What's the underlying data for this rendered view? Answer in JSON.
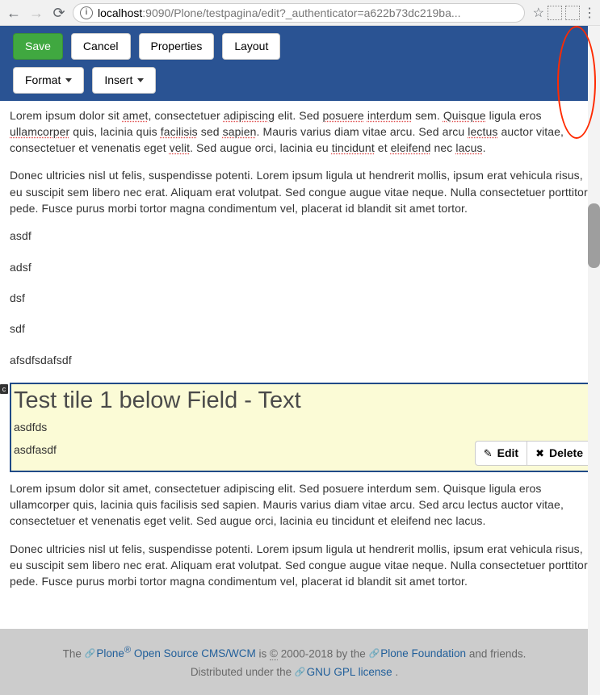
{
  "browser": {
    "url_prefix": "localhost",
    "url_suffix": ":9090/Plone/testpagina/edit?_authenticator=a622b73dc219ba...",
    "info_glyph": "i",
    "star_glyph": "☆",
    "menu_glyph": "⋮"
  },
  "toolbar": {
    "save": "Save",
    "cancel": "Cancel",
    "properties": "Properties",
    "layout": "Layout",
    "format": "Format",
    "insert": "Insert"
  },
  "content": {
    "para1_parts": {
      "t0": "Lorem ipsum dolor sit ",
      "w0": "amet",
      "t1": ", consectetuer ",
      "w1": "adipiscing",
      "t2": " elit. Sed ",
      "w2": "posuere",
      "t3": " ",
      "w3": "interdum",
      "t4": " sem. ",
      "w4": "Quisque",
      "t5": " ligula eros ",
      "w5": "ullamcorper",
      "t6": " quis, lacinia quis ",
      "w6": "facilisis",
      "t7": " sed ",
      "w7": "sapien",
      "t8": ". Mauris varius diam vitae arcu. Sed arcu ",
      "w8": "lectus",
      "t9": " auctor vitae, consectetuer et venenatis eget ",
      "w9": "velit",
      "t10": ". Sed augue orci, lacinia eu ",
      "w10": "tincidunt",
      "t11": " et ",
      "w11": "eleifend",
      "t12": " nec ",
      "w12": "lacus",
      "t13": "."
    },
    "para2": "Donec ultricies nisl ut felis, suspendisse potenti. Lorem ipsum ligula ut hendrerit mollis, ipsum erat vehicula risus, eu suscipit sem libero nec erat. Aliquam erat volutpat. Sed congue augue vitae neque. Nulla consectetuer porttitor pede. Fusce purus morbi tortor magna condimentum vel, placerat id blandit sit amet tortor.",
    "shorts": [
      "asdf",
      "adsf",
      "dsf",
      "sdf",
      "afsdfsdafsdf"
    ],
    "tile": {
      "badge": "c",
      "title": "Test tile 1 below Field - Text",
      "line1": "asdfds",
      "line2": "asdfasdf",
      "edit": "Edit",
      "delete": "Delete"
    },
    "para3": "Lorem ipsum dolor sit amet, consectetuer adipiscing elit. Sed posuere interdum sem. Quisque ligula eros ullamcorper quis, lacinia quis facilisis sed sapien. Mauris varius diam vitae arcu. Sed arcu lectus auctor vitae, consectetuer et venenatis eget velit. Sed augue orci, lacinia eu tincidunt et eleifend nec lacus.",
    "para4": "Donec ultricies nisl ut felis, suspendisse potenti. Lorem ipsum ligula ut hendrerit mollis, ipsum erat vehicula risus, eu suscipit sem libero nec erat. Aliquam erat volutpat. Sed congue augue vitae neque. Nulla consectetuer porttitor pede. Fusce purus morbi tortor magna condimentum vel, placerat id blandit sit amet tortor."
  },
  "footer": {
    "t0": "The ",
    "l0": "Plone",
    "sup0": "®",
    "l0b": " Open Source CMS/WCM",
    "t1": " is ",
    "abbr0": "©",
    "t2": " 2000-2018 by the ",
    "l1": "Plone Foundation",
    "t3": " and friends.",
    "t4": "Distributed under the ",
    "l2": "GNU GPL license",
    "t5": "."
  }
}
